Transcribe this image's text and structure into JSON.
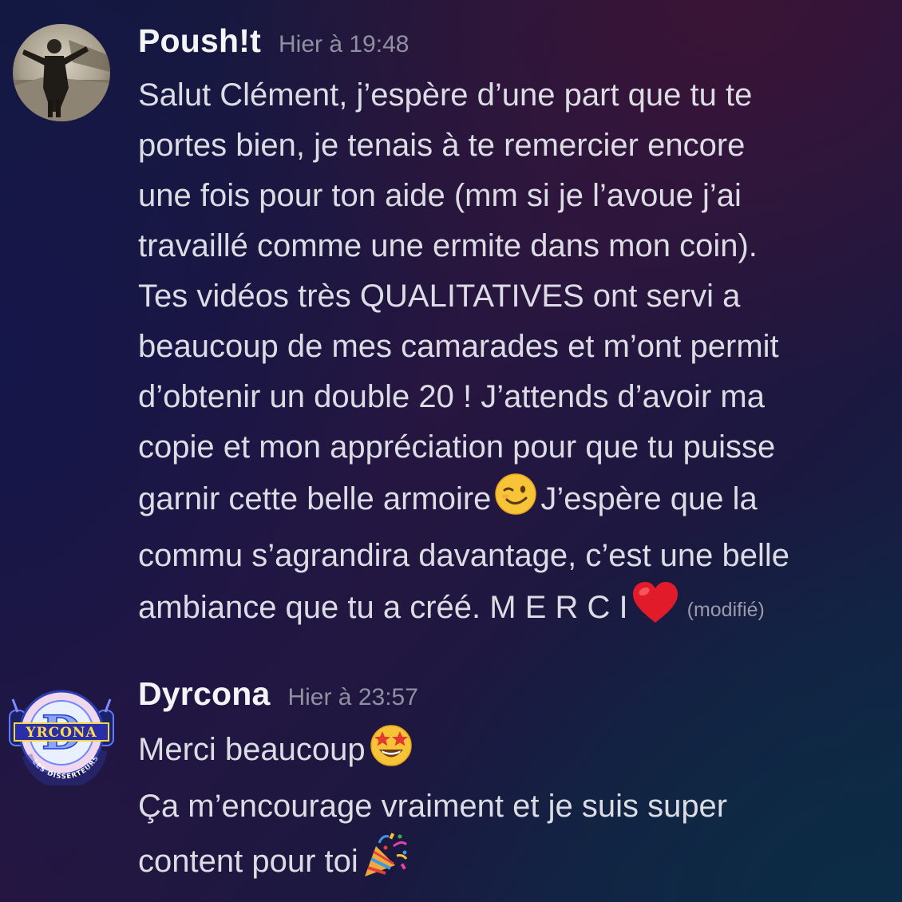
{
  "messages": [
    {
      "author": "Poush!t",
      "timestamp": "Hier à 19:48",
      "lines": [
        "Salut Clément, j’espère d’une part que tu te",
        "portes bien, je tenais à te remercier encore",
        "une fois pour ton aide (mm si je l’avoue j’ai",
        "travaillé comme une ermite dans mon coin).",
        "Tes vidéos très QUALITATIVES ont servi a",
        "beaucoup de mes camarades et m’ont permit",
        "d’obtenir un double 20 ! J’attends d’avoir ma",
        "copie et mon appréciation pour que tu puisse"
      ],
      "line9_before": "garnir cette belle armoire",
      "line9_after": "J’espère que la",
      "line10": "commu s’agrandira davantage, c’est une belle",
      "line11": "ambiance que tu a créé. M E R C I",
      "edited_label": "(modifié)",
      "emojis": [
        "winking-face",
        "red-heart"
      ]
    },
    {
      "author": "Dyrcona",
      "timestamp": "Hier à 23:57",
      "line1": "Merci beaucoup",
      "line2": "Ça m’encourage vraiment et je suis super",
      "line3": "content pour toi",
      "emojis": [
        "star-struck-face",
        "party-popper"
      ]
    }
  ],
  "avatar_text": {
    "brand": "YRCONA",
    "letter": "D",
    "ring": "LES DISSERTEURS"
  },
  "colors": {
    "username": "#f4f4f6",
    "timestamp": "#8f90a0",
    "text": "#dcdce4",
    "edited": "#9a9aab"
  }
}
